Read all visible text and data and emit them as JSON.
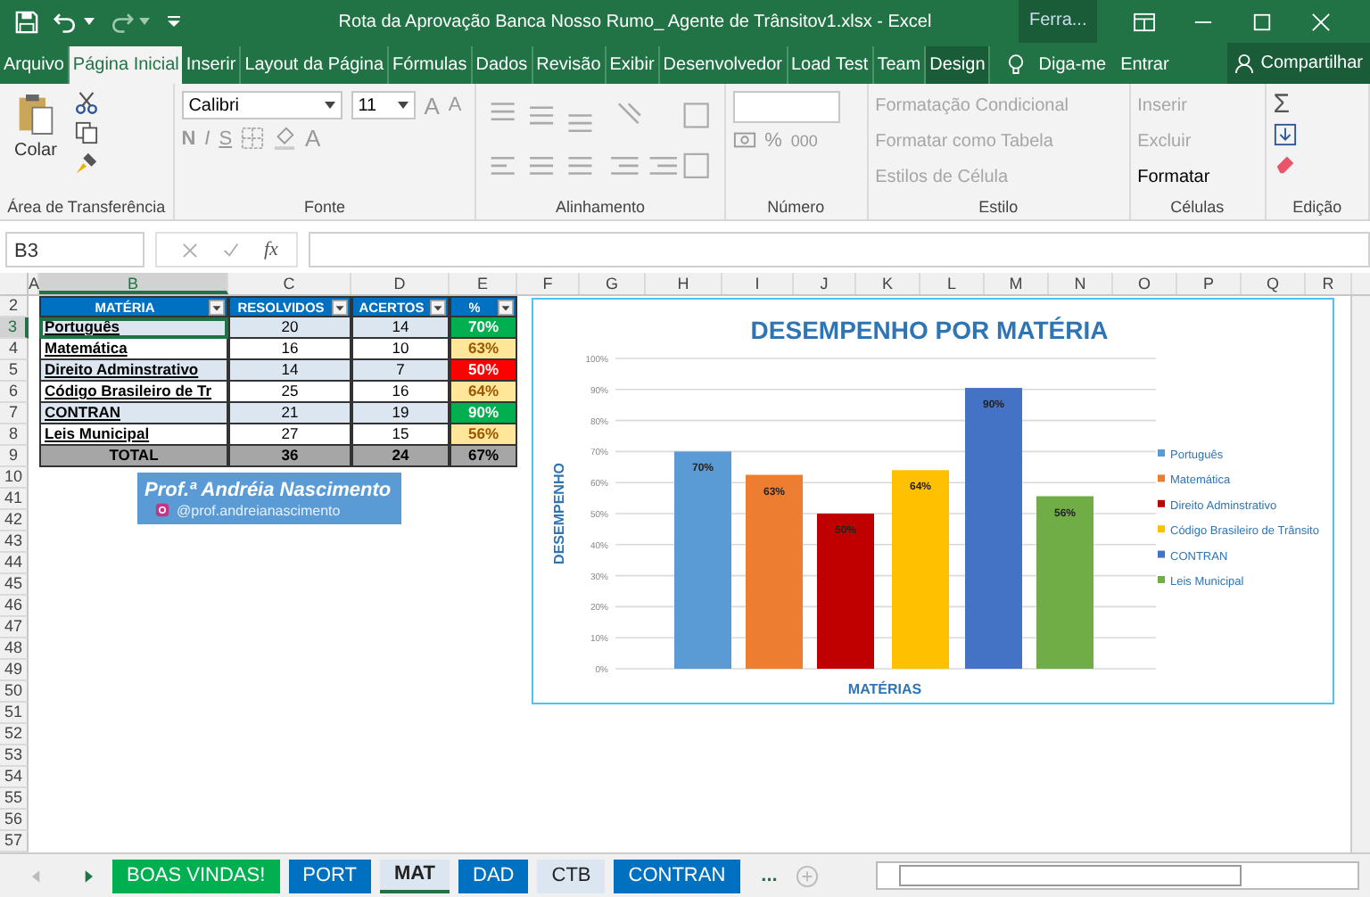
{
  "title_bar": {
    "title": "Rota da Aprovação Banca Nosso Rumo_ Agente de Trânsitov1.xlsx - Excel",
    "contextual": "Ferra..."
  },
  "ribbon_tabs": [
    {
      "label": "Arquivo",
      "selected": false,
      "contextual": false
    },
    {
      "label": "Página Inicial",
      "selected": true,
      "contextual": false
    },
    {
      "label": "Inserir",
      "selected": false,
      "contextual": false
    },
    {
      "label": "Layout da Página",
      "selected": false,
      "contextual": false
    },
    {
      "label": "Fórmulas",
      "selected": false,
      "contextual": false
    },
    {
      "label": "Dados",
      "selected": false,
      "contextual": false
    },
    {
      "label": "Revisão",
      "selected": false,
      "contextual": false
    },
    {
      "label": "Exibir",
      "selected": false,
      "contextual": false
    },
    {
      "label": "Desenvolvedor",
      "selected": false,
      "contextual": false
    },
    {
      "label": "Load Test",
      "selected": false,
      "contextual": false
    },
    {
      "label": "Team",
      "selected": false,
      "contextual": false
    },
    {
      "label": "Design",
      "selected": false,
      "contextual": true
    }
  ],
  "tell_me": "Diga-me",
  "sign_in": "Entrar",
  "share": "Compartilhar",
  "ribbon": {
    "paste": "Colar",
    "font_name": "Calibri",
    "font_size": "11",
    "grow": "A",
    "shrink": "A",
    "styles": [
      "N",
      "I",
      "S"
    ],
    "font_color": "A",
    "percent": "%",
    "thousands": "000",
    "autosum": "Σ",
    "style_commands": [
      {
        "label": "Formatação Condicional",
        "disabled": true
      },
      {
        "label": "Formatar como Tabela",
        "disabled": true
      },
      {
        "label": "Estilos de Célula",
        "disabled": true
      }
    ],
    "cell_commands": [
      {
        "label": "Inserir",
        "disabled": true
      },
      {
        "label": "Excluir",
        "disabled": true
      },
      {
        "label": "Formatar",
        "disabled": false
      }
    ],
    "groups": [
      "Área de Transferência",
      "Fonte",
      "Alinhamento",
      "Número",
      "Estilo",
      "Células",
      "Edição"
    ]
  },
  "formula_bar": {
    "name_box": "B3",
    "fx": "fx"
  },
  "columns": [
    "A",
    "B",
    "C",
    "D",
    "E",
    "F",
    "G",
    "H",
    "I",
    "J",
    "K",
    "L",
    "M",
    "N",
    "O",
    "P",
    "Q",
    "R"
  ],
  "row_numbers": [
    "2",
    "3",
    "4",
    "5",
    "6",
    "7",
    "8",
    "9",
    "10",
    "41",
    "42",
    "43",
    "44",
    "45",
    "46",
    "47",
    "48",
    "49",
    "50",
    "51",
    "52",
    "53",
    "54",
    "55",
    "56",
    "57"
  ],
  "table": {
    "columns": [
      "MATÉRIA",
      "RESOLVIDOS",
      "ACERTOS",
      "%"
    ],
    "rows": [
      {
        "materia": "Português",
        "resolvidos": "20",
        "acertos": "14",
        "percent": "70%",
        "color": "#00b050",
        "selected": true
      },
      {
        "materia": "Matemática",
        "resolvidos": "16",
        "acertos": "10",
        "percent": "63%",
        "color": "#ffe699",
        "selected": false
      },
      {
        "materia": "Direito Adminstrativo",
        "resolvidos": "14",
        "acertos": "7",
        "percent": "50%",
        "color": "#ff0000",
        "selected": false
      },
      {
        "materia": "Código Brasileiro de Tr",
        "resolvidos": "25",
        "acertos": "16",
        "percent": "64%",
        "color": "#ffe699",
        "selected": false
      },
      {
        "materia": "CONTRAN",
        "resolvidos": "21",
        "acertos": "19",
        "percent": "90%",
        "color": "#00b050",
        "selected": false
      },
      {
        "materia": "Leis Municipal",
        "resolvidos": "27",
        "acertos": "15",
        "percent": "56%",
        "color": "#ffe699",
        "selected": false
      }
    ],
    "total": [
      "TOTAL",
      "36",
      "24",
      "67%"
    ]
  },
  "banner": {
    "name": "Prof.ª Andréia Nascimento",
    "handle": "@prof.andreianascimento"
  },
  "chart": {
    "chart_data": {
      "type": "bar",
      "title": "DESEMPENHO POR MATÉRIA",
      "xlabel": "MATÉRIAS",
      "ylabel": "DESEMPENHO",
      "ylim": [
        0,
        100
      ],
      "yticks": [
        {
          "value": 0,
          "label": "0%"
        },
        {
          "value": 10,
          "label": "10%"
        },
        {
          "value": 20,
          "label": "20%"
        },
        {
          "value": 30,
          "label": "30%"
        },
        {
          "value": 40,
          "label": "40%"
        },
        {
          "value": 50,
          "label": "50%"
        },
        {
          "value": 60,
          "label": "60%"
        },
        {
          "value": 70,
          "label": "70%"
        },
        {
          "value": 80,
          "label": "80%"
        },
        {
          "value": 90,
          "label": "90%"
        },
        {
          "value": 100,
          "label": "100%"
        }
      ],
      "data_labels": true,
      "grid": true,
      "legend": true,
      "series": [
        {
          "name": "Português",
          "color": "#5b9bd5",
          "values": [
            70
          ],
          "value_labels": [
            "70%"
          ]
        },
        {
          "name": "Matemática",
          "color": "#ed7d31",
          "values": [
            62.5
          ],
          "value_labels": [
            "63%"
          ]
        },
        {
          "name": "Direito Adminstrativo",
          "color": "#c00000",
          "values": [
            50
          ],
          "value_labels": [
            "50%"
          ]
        },
        {
          "name": "Código Brasileiro de Trânsito",
          "color": "#ffc000",
          "values": [
            64
          ],
          "value_labels": [
            "64%"
          ]
        },
        {
          "name": "CONTRAN",
          "color": "#4472c4",
          "values": [
            90.5
          ],
          "value_labels": [
            "90%"
          ]
        },
        {
          "name": "Leis Municipal",
          "color": "#70ad47",
          "values": [
            55.6
          ],
          "value_labels": [
            "56%"
          ]
        }
      ]
    }
  },
  "sheet_tabs": [
    {
      "label": "BOAS VINDAS!",
      "color": "#00b050",
      "selected": false
    },
    {
      "label": "PORT",
      "color": "#0070c0",
      "selected": false
    },
    {
      "label": "MAT",
      "color": "#dce6f1",
      "selected": true
    },
    {
      "label": "DAD",
      "color": "#0070c0",
      "selected": false
    },
    {
      "label": "CTB",
      "color": "#dce6f1",
      "selected": false
    },
    {
      "label": "CONTRAN",
      "color": "#0070c0",
      "selected": false
    }
  ],
  "more_sheets": "..."
}
